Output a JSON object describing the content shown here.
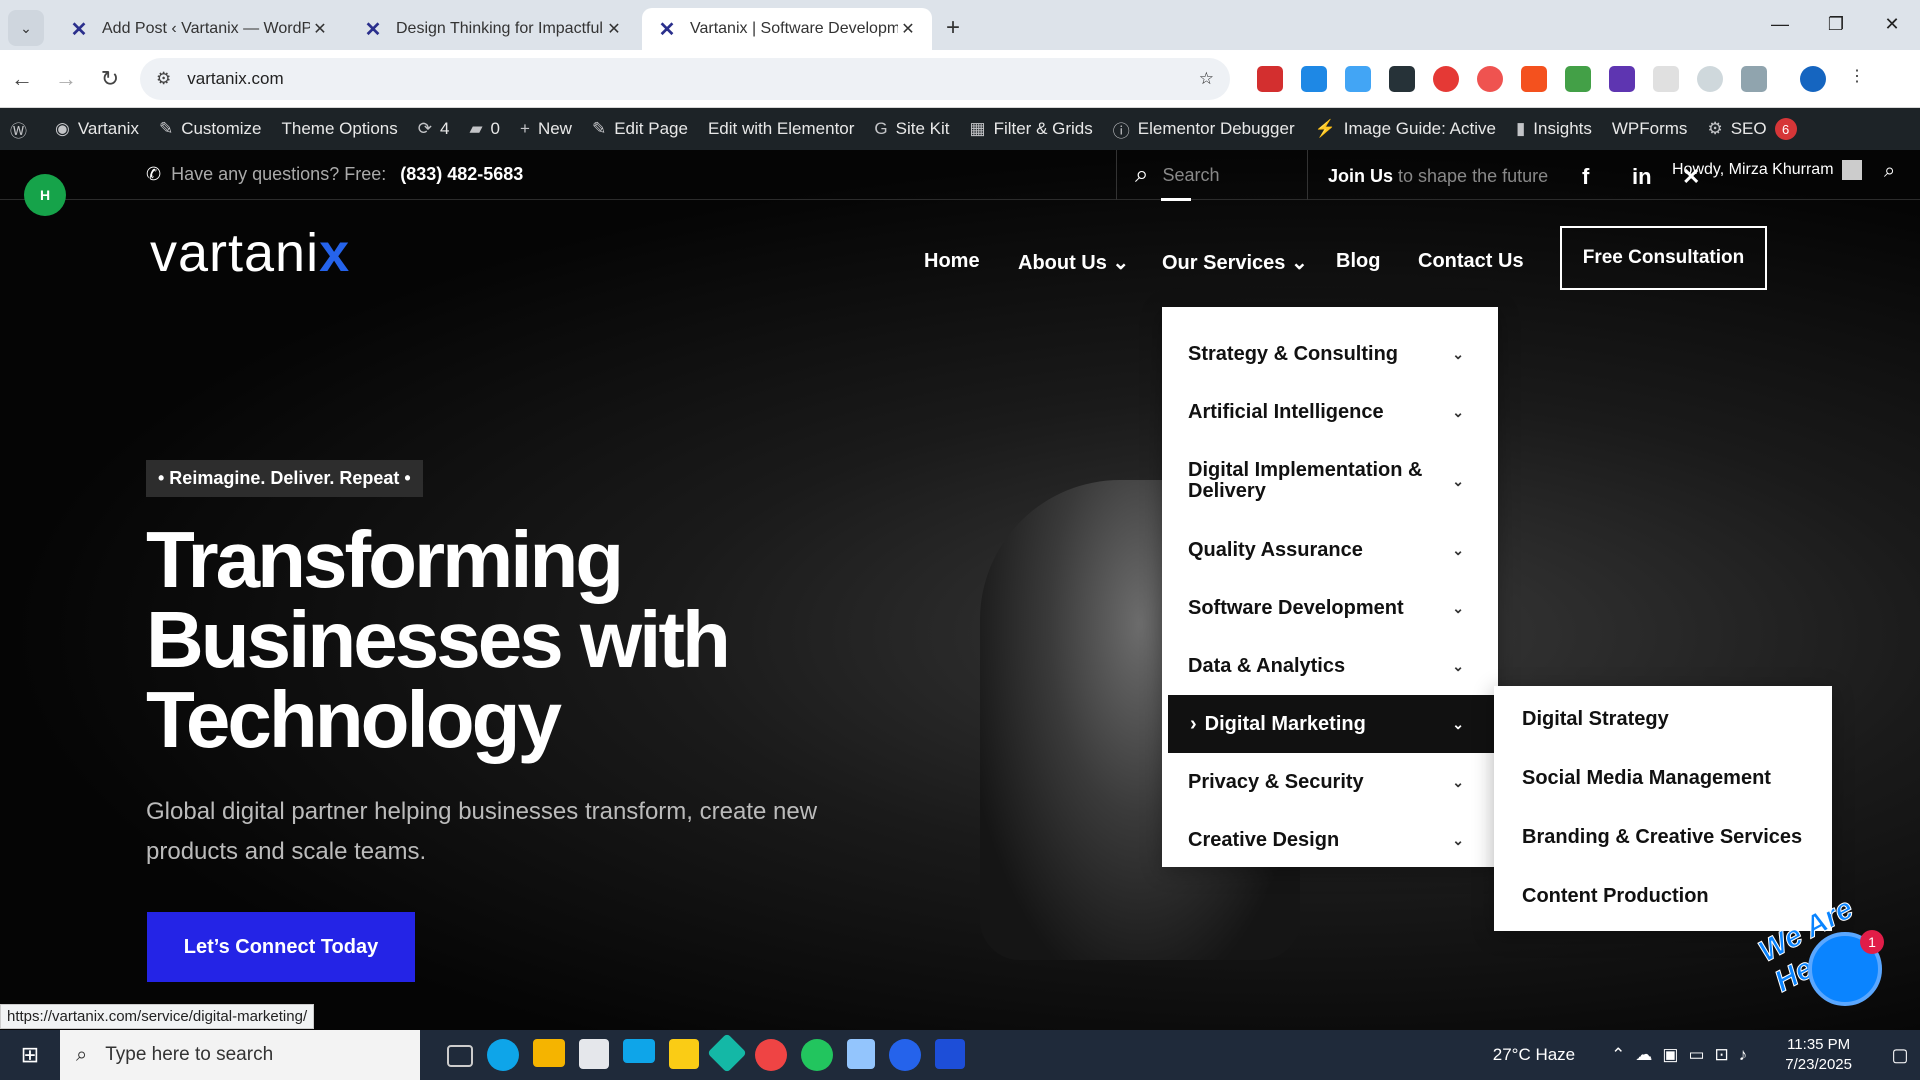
{
  "browser": {
    "tabs": [
      {
        "title": "Add Post ‹ Vartanix — WordPress",
        "active": false
      },
      {
        "title": "Design Thinking for Impactful V",
        "active": false
      },
      {
        "title": "Vartanix | Software Developmen",
        "active": true
      }
    ],
    "tab_close": "✕",
    "new_tab": "+",
    "url": "vartanix.com",
    "window": {
      "minimize": "—",
      "restore": "❐",
      "close": "✕"
    }
  },
  "wp_admin_bar": {
    "items": [
      {
        "label": "Vartanix",
        "icon": "dashboard-icon"
      },
      {
        "label": "Customize",
        "icon": "brush-icon"
      },
      {
        "label": "Theme Options",
        "icon": ""
      },
      {
        "label": "4",
        "icon": "refresh-icon"
      },
      {
        "label": "0",
        "icon": "comment-icon"
      },
      {
        "label": "New",
        "icon": "plus-icon"
      },
      {
        "label": "Edit Page",
        "icon": "pencil-icon"
      },
      {
        "label": "Edit with Elementor",
        "icon": ""
      },
      {
        "label": "Site Kit",
        "icon": "google-icon"
      },
      {
        "label": "Filter & Grids",
        "icon": "grid-icon"
      },
      {
        "label": "Elementor Debugger",
        "icon": "info-icon"
      },
      {
        "label": "Image Guide: Active",
        "icon": "bolt-icon"
      },
      {
        "label": "Insights",
        "icon": "chart-icon"
      },
      {
        "label": "WPForms",
        "icon": ""
      },
      {
        "label": "SEO",
        "icon": "seo-gear-icon",
        "badge": "6"
      }
    ]
  },
  "site": {
    "top": {
      "question": "Have any questions? Free:",
      "phone": "(833) 482-5683",
      "search_placeholder": "Search",
      "join_bold": "Join Us",
      "join_rest": " to shape the future",
      "howdy": "Howdy, Mirza Khurram",
      "green_badge": "H"
    },
    "logo": {
      "text": "vartani",
      "x": "x"
    },
    "menu": [
      {
        "label": "Home"
      },
      {
        "label": "About Us ⌄"
      },
      {
        "label": "Our Services ⌄"
      },
      {
        "label": "Blog"
      },
      {
        "label": "Contact Us"
      }
    ],
    "cta": "Free Consultation",
    "hero": {
      "tagline": "• Reimagine. Deliver. Repeat •",
      "headline": "Transforming Businesses with Technology",
      "subtitle": "Global digital partner helping businesses transform, create new products and scale teams.",
      "button": "Let’s Connect Today"
    },
    "services_dropdown": [
      {
        "label": "Strategy & Consulting"
      },
      {
        "label": "Artificial Intelligence"
      },
      {
        "label": "Digital Implementation & Delivery"
      },
      {
        "label": "Quality Assurance"
      },
      {
        "label": "Software Development"
      },
      {
        "label": "Data & Analytics"
      },
      {
        "label": "Digital Marketing",
        "active": true
      },
      {
        "label": "Privacy & Security"
      },
      {
        "label": "Creative Design"
      }
    ],
    "digital_marketing_submenu": [
      {
        "label": "Digital Strategy"
      },
      {
        "label": "Social Media Management"
      },
      {
        "label": "Branding & Creative Services"
      },
      {
        "label": "Content Production"
      }
    ],
    "chat": {
      "badge": "1",
      "label": "We Are Here!"
    }
  },
  "status_url": "https://vartanix.com/service/digital-marketing/",
  "taskbar": {
    "search_placeholder": "Type here to search",
    "weather": "27°C  Haze",
    "time": "11:35 PM",
    "date": "7/23/2025"
  }
}
